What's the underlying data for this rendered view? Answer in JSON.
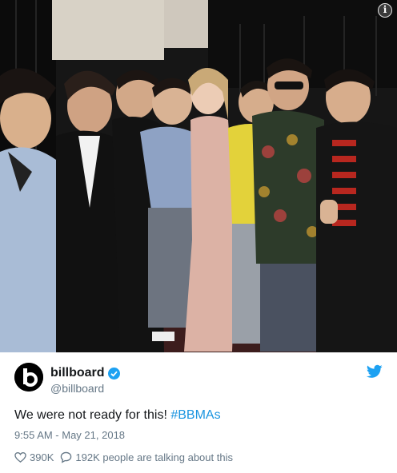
{
  "tweet": {
    "display_name": "billboard",
    "handle": "@billboard",
    "text_plain": "We were not ready for this! ",
    "hashtag": "#BBMAs",
    "timestamp": "9:55 AM - May 21, 2018",
    "likes": "390K",
    "talking": "192K people are talking about this",
    "verified": true
  },
  "icons": {
    "info": "info-icon",
    "verified": "verified-badge-icon",
    "twitter": "twitter-bird-icon",
    "like": "heart-icon",
    "reply": "speech-bubble-icon"
  },
  "colors": {
    "accent": "#1da1f2",
    "hashtag": "#1b95e0",
    "secondary_text": "#657786"
  },
  "overlay": {
    "info_glyph": "i"
  }
}
